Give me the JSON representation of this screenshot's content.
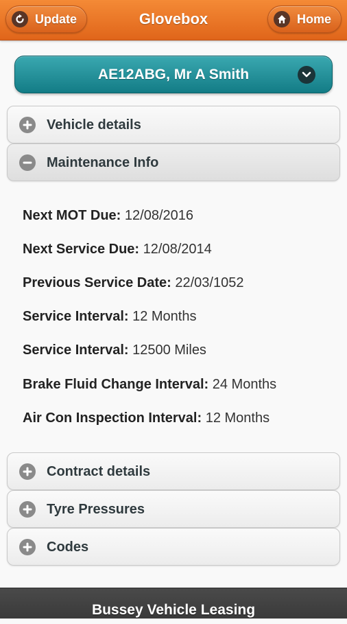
{
  "header": {
    "title": "Glovebox",
    "update_label": "Update",
    "home_label": "Home"
  },
  "vehicle_select": {
    "selected": "AE12ABG, Mr A Smith"
  },
  "sections": {
    "vehicle_details": {
      "label": "Vehicle details",
      "state": "collapsed"
    },
    "maintenance_info": {
      "label": "Maintenance Info",
      "state": "expanded"
    },
    "contract_details": {
      "label": "Contract details",
      "state": "collapsed"
    },
    "tyre_pressures": {
      "label": "Tyre Pressures",
      "state": "collapsed"
    },
    "codes": {
      "label": "Codes",
      "state": "collapsed"
    }
  },
  "maintenance": [
    {
      "label": "Next MOT Due:",
      "value": "12/08/2016"
    },
    {
      "label": "Next Service Due:",
      "value": "12/08/2014"
    },
    {
      "label": "Previous Service Date:",
      "value": "22/03/1052"
    },
    {
      "label": "Service Interval:",
      "value": "12 Months"
    },
    {
      "label": "Service Interval:",
      "value": "12500 Miles"
    },
    {
      "label": "Brake Fluid Change Interval:",
      "value": "24 Months"
    },
    {
      "label": "Air Con Inspection Interval:",
      "value": "12 Months"
    }
  ],
  "footer": {
    "text": "Bussey Vehicle Leasing"
  },
  "colors": {
    "header_orange": "#e87428",
    "select_teal": "#1f8b94",
    "footer_dark": "#444444"
  }
}
